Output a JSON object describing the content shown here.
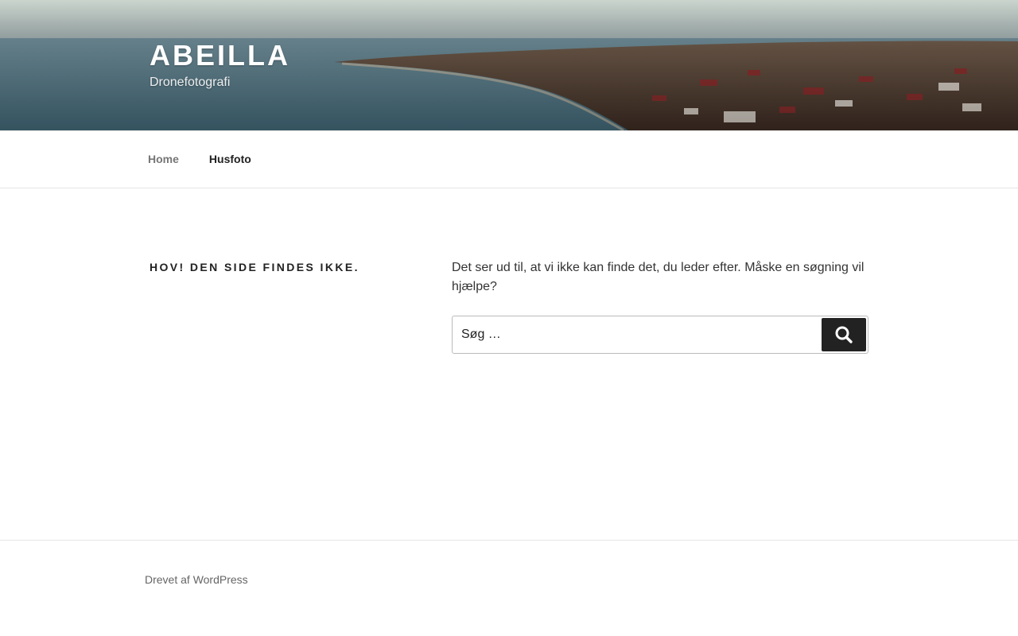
{
  "site": {
    "title": "ABEILLA",
    "description": "Dronefotografi"
  },
  "nav": {
    "items": [
      {
        "label": "Home"
      },
      {
        "label": "Husfoto"
      }
    ]
  },
  "main": {
    "page_title": "HOV! DEN SIDE FINDES IKKE.",
    "message": "Det ser ud til, at vi ikke kan finde det, du leder efter. Måske en søgning vil hjælpe?",
    "search": {
      "placeholder": "Søg …",
      "value": "",
      "button_icon": "search-icon"
    }
  },
  "footer": {
    "powered_by": "Drevet af WordPress"
  },
  "colors": {
    "text_dark": "#222222",
    "text_muted": "#767676",
    "search_button": "#222222",
    "border": "#e6e6e6"
  }
}
